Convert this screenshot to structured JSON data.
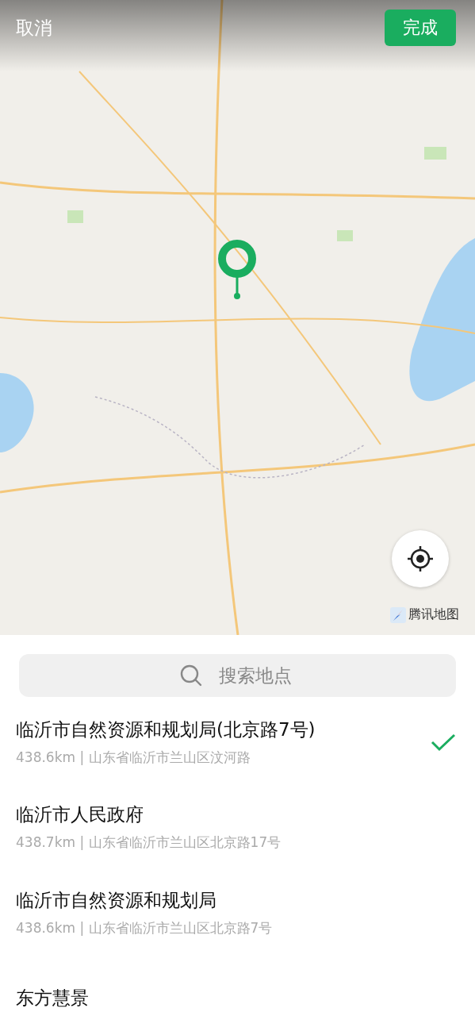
{
  "header": {
    "cancel": "取消",
    "done": "完成"
  },
  "map": {
    "kind": "picture",
    "attribution": "腾讯地图"
  },
  "search": {
    "placeholder": "搜索地点"
  },
  "places": [
    {
      "name": "临沂市自然资源和规划局(北京路7号)",
      "detail": "438.6km | 山东省临沂市兰山区汶河路",
      "selected": true
    },
    {
      "name": "临沂市人民政府",
      "detail": "438.7km | 山东省临沂市兰山区北京路17号",
      "selected": false
    },
    {
      "name": "临沂市自然资源和规划局",
      "detail": "438.6km | 山东省临沂市兰山区北京路7号",
      "selected": false
    },
    {
      "name": "东方慧景",
      "selected": false
    }
  ]
}
